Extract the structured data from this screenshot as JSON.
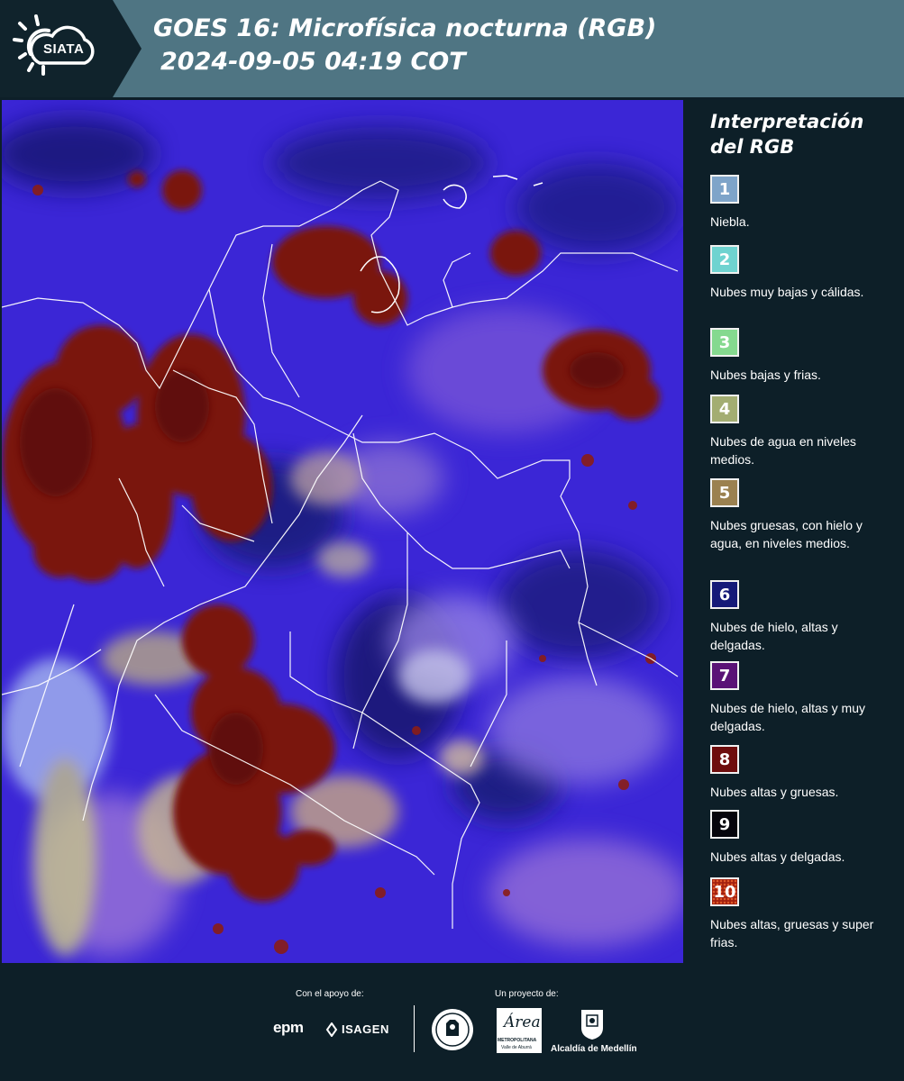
{
  "header": {
    "logo_text": "SIATA",
    "title_line1": "GOES 16: Microfísica nocturna (RGB)",
    "title_line2": "2024-09-05 04:19 COT"
  },
  "legend": {
    "title_line1": "Interpretación",
    "title_line2": "del RGB",
    "items": [
      {
        "number": "1",
        "label": "Niebla.",
        "color": "#7ea4c9"
      },
      {
        "number": "2",
        "label": "Nubes muy bajas y cálidas.",
        "color": "#6fd3d0"
      },
      {
        "number": "3",
        "label": "Nubes bajas y frias.",
        "color": "#85d98f"
      },
      {
        "number": "4",
        "label": "Nubes de agua en niveles medios.",
        "color": "#a3ad72"
      },
      {
        "number": "5",
        "label": "Nubes gruesas, con hielo y agua, en niveles medios.",
        "color": "#9b8150"
      },
      {
        "number": "6",
        "label": "Nubes de hielo, altas y delgadas.",
        "color": "#151a78"
      },
      {
        "number": "7",
        "label": "Nubes de hielo, altas y muy delgadas.",
        "color": "#5a1276"
      },
      {
        "number": "8",
        "label": "Nubes altas y gruesas.",
        "color": "#6e0d0d"
      },
      {
        "number": "9",
        "label": "Nubes altas y delgadas.",
        "color": "#05050c"
      },
      {
        "number": "10",
        "label": "Nubes altas, gruesas y super frias.",
        "color": "#b42a14"
      }
    ]
  },
  "footer": {
    "support_label": "Con el apoyo de:",
    "project_label": "Un proyecto de:",
    "epm": "epm",
    "isagen": "ISAGEN",
    "metropolitana": "METROPOLITANA",
    "valle": "Valle de Aburrá",
    "area": "Área",
    "alcaldia": "Alcaldía de Medellín"
  },
  "colors": {
    "header_bg": "#4f7583",
    "page_bg": "#0d1f28",
    "map_blue": "#3a22d8",
    "cloud_red": "#7a1410"
  }
}
